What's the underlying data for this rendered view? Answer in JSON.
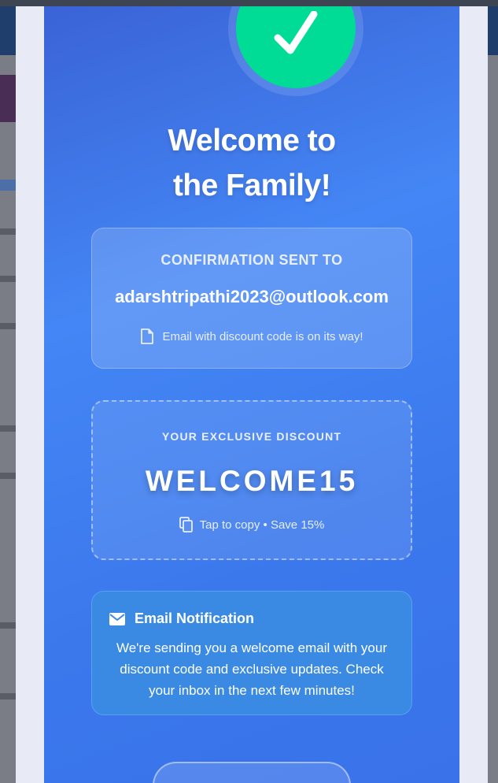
{
  "modal": {
    "title": "Welcome to the Family!",
    "confirmation": {
      "label": "CONFIRMATION SENT TO",
      "email": "adarshtripathi2023@outlook.com",
      "note": "Email with discount code is on its way!"
    },
    "discount": {
      "label": "YOUR EXCLUSIVE DISCOUNT",
      "code": "WELCOME15",
      "hint": "Tap to copy • Save 15%"
    },
    "notification": {
      "title": "Email Notification",
      "body": "We're sending you a welcome email with your discount code and exclusive updates. Check your inbox in the next few minutes!"
    },
    "icons": {
      "success": "checkmark-icon",
      "note": "document-icon",
      "copy": "copy-icon",
      "mail": "envelope-icon"
    }
  },
  "colors": {
    "card_gradient_start": "#3a63d6",
    "card_gradient_end": "#3a72ea",
    "success_green": "#00dc96",
    "notification_bg": "#3a8ae3",
    "frame": "#e8ebf5"
  }
}
